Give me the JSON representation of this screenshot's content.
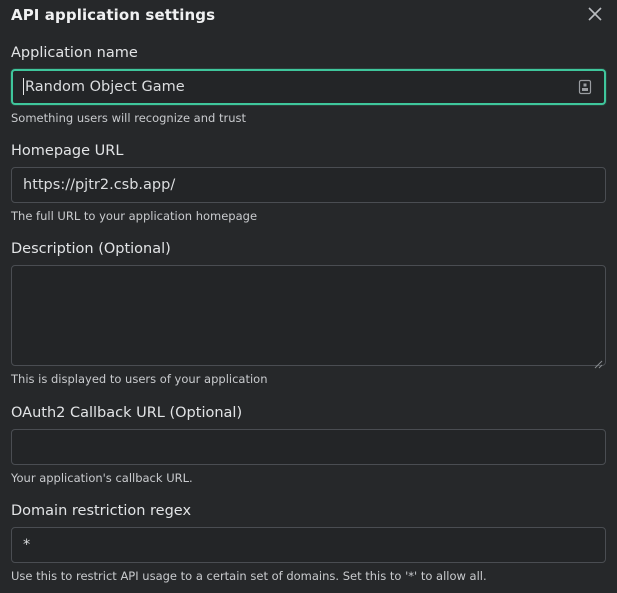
{
  "dialog": {
    "title": "API application settings"
  },
  "fields": {
    "app_name": {
      "label": "Application name",
      "value": "Random Object Game",
      "help": "Something users will recognize and trust"
    },
    "homepage": {
      "label": "Homepage URL",
      "value": "https://pjtr2.csb.app/",
      "help": "The full URL to your application homepage"
    },
    "description": {
      "label": "Description (Optional)",
      "value": "",
      "help": "This is displayed to users of your application"
    },
    "callback": {
      "label": "OAuth2 Callback URL (Optional)",
      "value": "",
      "help": "Your application's callback URL."
    },
    "domain": {
      "label": "Domain restriction regex",
      "value": "*",
      "help": "Use this to restrict API usage to a certain set of domains. Set this to '*' to allow all."
    }
  },
  "colors": {
    "background": "#26282a",
    "focus_border": "#3fc69c",
    "input_border": "#4a4d52"
  }
}
